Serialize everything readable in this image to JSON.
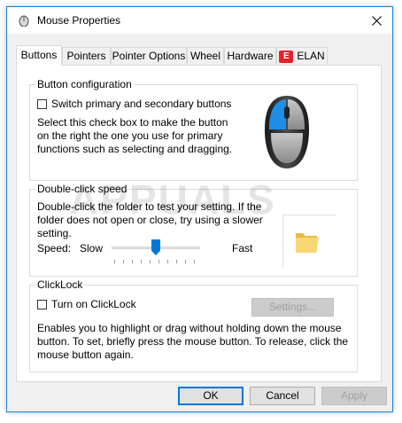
{
  "window": {
    "title": "Mouse Properties"
  },
  "tabs": [
    {
      "label": "Buttons",
      "active": true
    },
    {
      "label": "Pointers"
    },
    {
      "label": "Pointer Options"
    },
    {
      "label": "Wheel"
    },
    {
      "label": "Hardware"
    },
    {
      "label": "ELAN",
      "logo_text": "E"
    }
  ],
  "button_config": {
    "legend": "Button configuration",
    "checkbox_label": "Switch primary and secondary buttons",
    "checked": false,
    "description": "Select this check box to make the button on the right the one you use for primary functions such as selecting and dragging."
  },
  "double_click": {
    "legend": "Double-click speed",
    "description": "Double-click the folder to test your setting. If the folder does not open or close, try using a slower setting.",
    "speed_label": "Speed:",
    "slow_label": "Slow",
    "fast_label": "Fast",
    "speed_position": 0.5
  },
  "clicklock": {
    "legend": "ClickLock",
    "checkbox_label": "Turn on ClickLock",
    "checked": false,
    "settings_label": "Settings...",
    "description": "Enables you to highlight or drag without holding down the mouse button. To set, briefly press the mouse button. To release, click the mouse button again."
  },
  "footer": {
    "ok_label": "OK",
    "cancel_label": "Cancel",
    "apply_label": "Apply"
  },
  "watermark": "APPUALS",
  "colors": {
    "accent": "#0078d7",
    "mouse_highlight": "#1e8ee6"
  }
}
